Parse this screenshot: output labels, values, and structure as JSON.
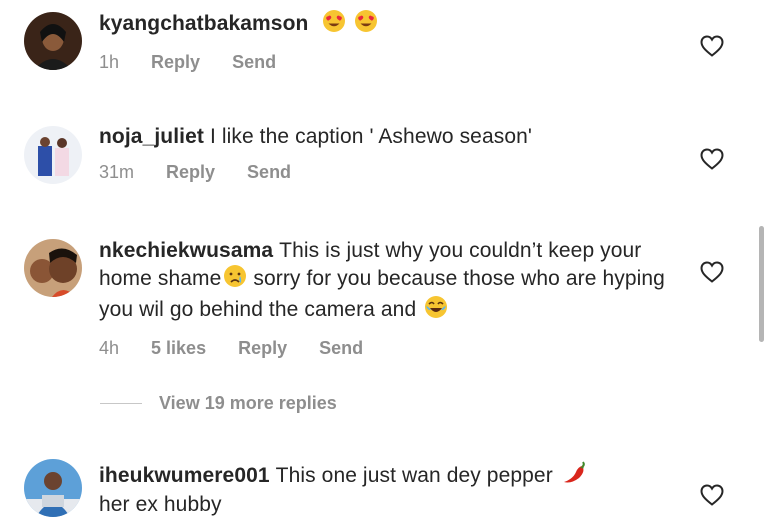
{
  "comments": [
    {
      "username": "kyangchatbakamson",
      "text": "",
      "emoji": [
        "heart-eyes",
        "heart-eyes"
      ],
      "time": "1h",
      "likes": "",
      "reply_label": "Reply",
      "send_label": "Send"
    },
    {
      "username": "noja_juliet",
      "text": "I like the caption ' Ashewo season'",
      "time": "31m",
      "reply_label": "Reply",
      "send_label": "Send"
    },
    {
      "username": "nkechiekwusama",
      "text_part1": "This is just why you couldn’t keep your home shame",
      "text_part2": "sorry for you because those who are hyping you wil go behind the camera and",
      "emoji": [
        "crying",
        "tears-of-joy"
      ],
      "time": "4h",
      "likes": "5 likes",
      "reply_label": "Reply",
      "send_label": "Send"
    },
    {
      "username": "iheukwumere001",
      "text": "This one just wan dey pepper",
      "text_part2": "her ex hubby",
      "emoji": [
        "hot-pepper"
      ]
    }
  ],
  "view_replies": "View 19 more replies",
  "icons": {
    "heart": "heart-outline-icon",
    "colors": {
      "username": "#262626",
      "meta": "#8e8e8e",
      "emoji_face": "#f7c531",
      "emoji_heart": "#e8283d",
      "pepper": "#d9261c"
    }
  }
}
